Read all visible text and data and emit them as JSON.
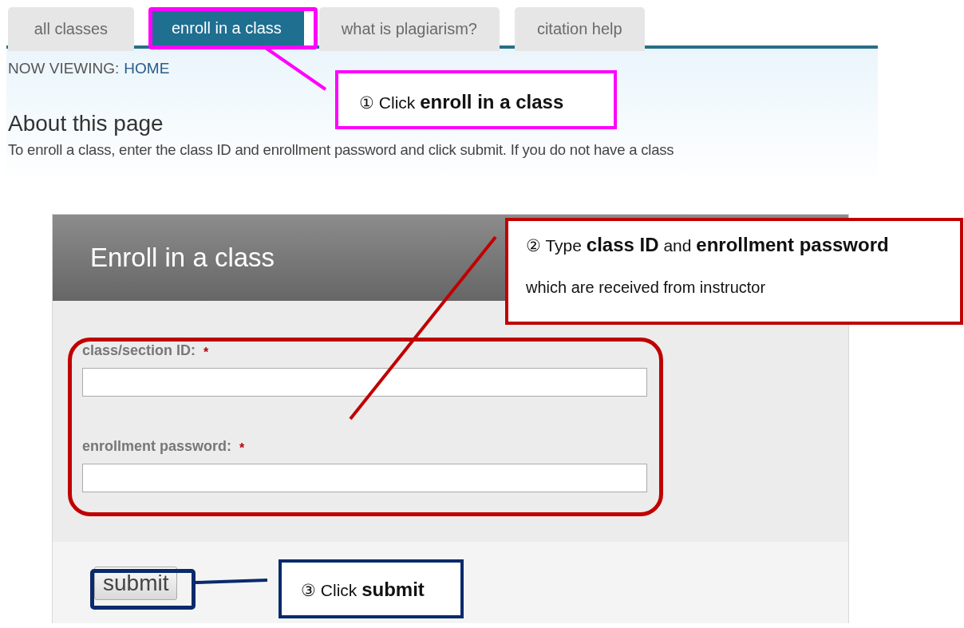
{
  "tabs": [
    {
      "label": "all classes",
      "selected": false
    },
    {
      "label": "enroll in a class",
      "selected": true
    },
    {
      "label": "what is plagiarism?",
      "selected": false
    },
    {
      "label": "citation help",
      "selected": false
    }
  ],
  "breadcrumb": {
    "label": "NOW VIEWING:",
    "link": "HOME"
  },
  "about": {
    "heading": "About this page",
    "text": "To enroll a class, enter the class ID and enrollment password and click submit. If you do not have a class"
  },
  "form": {
    "title": "Enroll in a class",
    "fields": [
      {
        "label": "class/section ID:",
        "required_mark": "*"
      },
      {
        "label": "enrollment password:",
        "required_mark": "*"
      }
    ],
    "submit": "submit"
  },
  "annotations": [
    {
      "color": "#ff00ff",
      "lines": [
        "① Click **enroll in a class**"
      ]
    },
    {
      "color": "#c00000",
      "lines": [
        "②  Type **class ID** and **enrollment password**",
        "which are received from instructor"
      ]
    },
    {
      "color": "#0a2a6b",
      "lines": [
        "③ Click **submit**"
      ]
    }
  ]
}
